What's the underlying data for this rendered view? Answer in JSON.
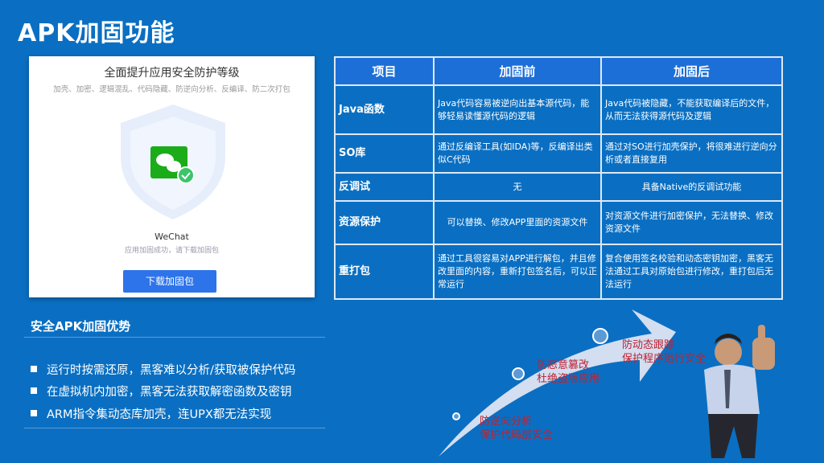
{
  "title": "APK加固功能",
  "card": {
    "heading": "全面提升应用安全防护等级",
    "subtitle": "加壳、加密、逻辑混乱、代码隐藏、防逆向分析、反编译、防二次打包",
    "app_name": "WeChat",
    "status": "应用加固成功，请下载加固包",
    "download_button": "下载加固包"
  },
  "table": {
    "headers": [
      "项目",
      "加固前",
      "加固后"
    ],
    "rows": [
      {
        "item": "Java函数",
        "before": "Java代码容易被逆向出基本源代码，能够轻易读懂源代码的逻辑",
        "after": "Java代码被隐藏，不能获取编译后的文件，从而无法获得源代码及逻辑"
      },
      {
        "item": "SO库",
        "before": "通过反编译工具(如IDA)等，反编译出类似C代码",
        "after": "通过对SO进行加壳保护，将很难进行逆向分析或者直接复用"
      },
      {
        "item": "反调试",
        "before": "无",
        "after": "具备Native的反调试功能"
      },
      {
        "item": "资源保护",
        "before": "可以替换、修改APP里面的资源文件",
        "after": "对资源文件进行加密保护，无法替换、修改资源文件"
      },
      {
        "item": "重打包",
        "before": "通过工具很容易对APP进行解包，并且修改里面的内容，重新打包签名后，可以正常运行",
        "after": "复合使用签名校验和动态密钥加密，黑客无法通过工具对原始包进行修改，重打包后无法运行"
      }
    ]
  },
  "advantages": {
    "heading": "安全APK加固优势",
    "items": [
      "运行时按需还原，黑客难以分析/获取被保护代码",
      "在虚拟机内加密，黑客无法获取解密函数及密钥",
      "ARM指令集动态库加壳，连UPX都无法实现"
    ]
  },
  "steps": [
    {
      "line1": "防逆向分析",
      "line2": "保护代码层安全"
    },
    {
      "line1": "防恶意篡改",
      "line2": "杜绝盗版应用"
    },
    {
      "line1": "防动态跟踪",
      "line2": "保护程序运行安全"
    }
  ]
}
